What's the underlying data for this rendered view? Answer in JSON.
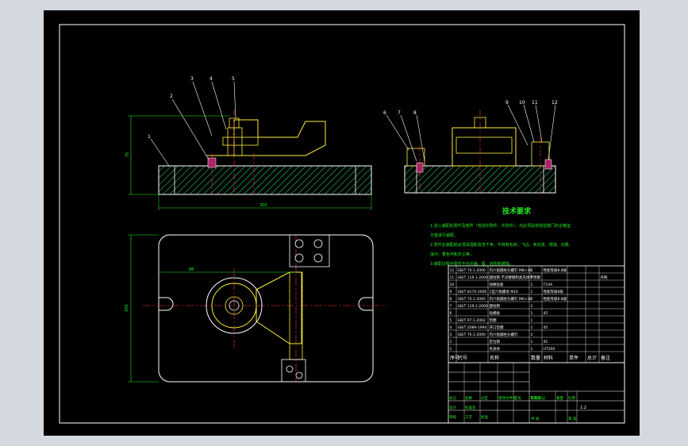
{
  "drawing": {
    "colors": {
      "background": "#000000",
      "frame": "#ffffff",
      "outline": "#ffffff",
      "hatch": "#22cc77",
      "fixture": "#ffee33",
      "dimension": "#22ee22",
      "center_line": "#ff3344",
      "title_text": "#22ee22",
      "note_text": "#22ee22",
      "outer_page": "#d4d9df"
    },
    "front_view": {
      "part_numbers": [
        "1",
        "2",
        "3",
        "4",
        "5"
      ],
      "dim_height": "75",
      "dim_length": "300"
    },
    "side_view": {
      "part_numbers": [
        "6",
        "7",
        "8",
        "9",
        "10",
        "11",
        "12"
      ]
    },
    "top_view": {
      "dim_width": "200",
      "dim_offset": "88"
    },
    "tech_requirements": {
      "title": "技术要求",
      "lines": [
        "1.进入装配的零件及部件（包括外购件、外协件），均必须具有检验部门的合格证",
        "方能进行装配。",
        "2.零件在装配前必须清理和清洗干净，不得有毛刺、飞边、氧化皮、锈蚀、切屑、",
        "油污、着色剂和灰尘等。",
        "3.装配过程中零件不允许磕、碰、划伤和锈蚀。"
      ]
    },
    "bom": {
      "headers": [
        "序号",
        "代号",
        "名称",
        "数量",
        "材料",
        "单件",
        "总计",
        "备注"
      ],
      "rows": [
        [
          "12",
          "GB/T 70.1-2000",
          "内六角圆柱头螺钉 M8×16",
          "2",
          "性能等级8.8级",
          "",
          "",
          ""
        ],
        [
          "11",
          "GB/T 119.1-2000",
          "圆柱销 不淬硬钢和奥氏体不锈钢",
          "2",
          "",
          "",
          "",
          "外购"
        ],
        [
          "10",
          "",
          "快换钻套",
          "1",
          "T10A",
          "",
          "",
          ""
        ],
        [
          "9",
          "GB/T 6170-2000",
          "1型六角螺母 M16",
          "1",
          "性能等级8级",
          "",
          "",
          ""
        ],
        [
          "8",
          "GB/T 70.1-2000",
          "内六角圆柱头螺钉 M6×16",
          "2",
          "性能等级8.8级",
          "",
          "",
          ""
        ],
        [
          "7",
          "GB/T 119.1-2000",
          "圆柱销",
          "2",
          "",
          "",
          "",
          ""
        ],
        [
          "6",
          "",
          "钻模板",
          "1",
          "45",
          "",
          "",
          ""
        ],
        [
          "5",
          "GB/T 97.1-2002",
          "垫圈",
          "1",
          "",
          "",
          "",
          ""
        ],
        [
          "4",
          "GB/T 2089-1994",
          "开口垫圈",
          "1",
          "45",
          "",
          "",
          ""
        ],
        [
          "3",
          "GB/T 70.1-2000",
          "内六角圆柱头螺钉",
          "2",
          "",
          "",
          "",
          ""
        ],
        [
          "2",
          "",
          "定位销",
          "1",
          "45",
          "",
          "",
          ""
        ],
        [
          "1",
          "",
          "夹具体",
          "1",
          "HT200",
          "",
          "",
          ""
        ]
      ]
    },
    "title_block": {
      "fields": [
        "标记",
        "处数",
        "分区",
        "更改文件号",
        "签名",
        "年月日",
        "设计",
        "标准化",
        "阶段标记",
        "重量",
        "比例",
        "审核",
        "工艺",
        "批准",
        "共 张",
        "第 张"
      ],
      "scale": "1:2"
    }
  }
}
